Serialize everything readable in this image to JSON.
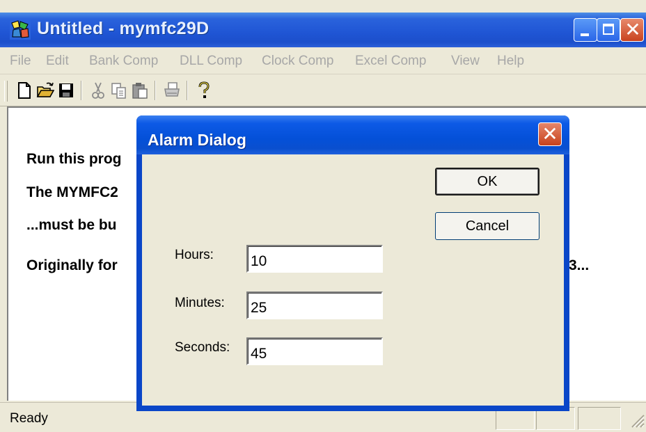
{
  "window": {
    "title": "Untitled - mymfc29D",
    "app_icon": "mfc-app-icon"
  },
  "menu": {
    "items": [
      {
        "label": "File"
      },
      {
        "label": "Edit"
      },
      {
        "label": "Bank Comp"
      },
      {
        "label": "DLL Comp"
      },
      {
        "label": "Clock Comp"
      },
      {
        "label": "Excel Comp"
      },
      {
        "label": "View"
      },
      {
        "label": "Help"
      }
    ]
  },
  "toolbar": {
    "icons": [
      "new-icon",
      "open-icon",
      "save-icon",
      "cut-icon",
      "copy-icon",
      "paste-icon",
      "print-icon",
      "help-icon"
    ]
  },
  "client": {
    "lines": [
      "Run this prog",
      "The MYMFC2",
      "...must be bu",
      "Originally for"
    ],
    "right_fragment": "3..."
  },
  "statusbar": {
    "text": "Ready"
  },
  "dialog": {
    "title": "Alarm Dialog",
    "ok_label": "OK",
    "cancel_label": "Cancel",
    "fields": [
      {
        "label": "Hours:",
        "value": "10"
      },
      {
        "label": "Minutes:",
        "value": "25"
      },
      {
        "label": "Seconds:",
        "value": "45"
      }
    ]
  },
  "colors": {
    "title_bar": "#1f55d4",
    "dialog_frame": "#0a46c8",
    "close_button": "#c9431f",
    "face": "#ece9d8"
  }
}
